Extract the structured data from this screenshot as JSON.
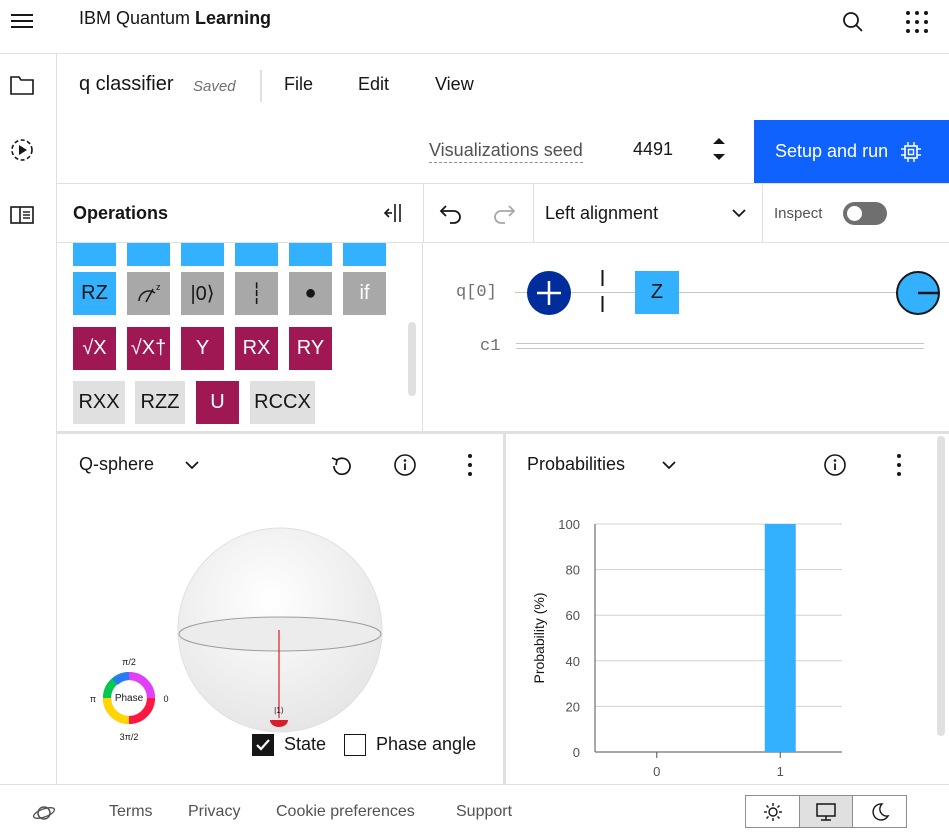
{
  "header": {
    "brand_prefix": "IBM Quantum ",
    "brand_bold": "Learning"
  },
  "composer": {
    "file_title": "q classifier",
    "saved_status": "Saved",
    "menu": [
      "File",
      "Edit",
      "View"
    ],
    "seed_label": "Visualizations seed",
    "seed_value": "4491",
    "run_label": "Setup and run"
  },
  "toolbar": {
    "operations_title": "Operations",
    "alignment": "Left alignment",
    "inspect_label": "Inspect",
    "inspect_on": false
  },
  "palette": {
    "row1": [
      "RZ",
      "",
      "|0⟩",
      "┆",
      "●",
      "if"
    ],
    "row2": [
      "√X",
      "√X†",
      "Y",
      "RX",
      "RY"
    ],
    "row3": [
      "RXX",
      "RZZ",
      "U",
      "RCCX"
    ]
  },
  "circuit": {
    "qubit_label": "q[0]",
    "classical_label": "c1",
    "gate_z": "Z"
  },
  "qsphere": {
    "title": "Q-sphere",
    "phase_label": "Phase",
    "phase_top": "π/2",
    "phase_left": "π",
    "phase_right": "0",
    "phase_bottom": "3π/2",
    "state_ket": "|1⟩",
    "state_checkbox": "State",
    "state_checked": true,
    "phase_checkbox": "Phase angle",
    "phase_checked": false
  },
  "probabilities": {
    "title": "Probabilities"
  },
  "chart_data": {
    "type": "bar",
    "categories": [
      "0",
      "1"
    ],
    "values": [
      0,
      100
    ],
    "ylabel": "Probability (%)",
    "xlabel": "",
    "ylim": [
      0,
      100
    ],
    "yticks": [
      0,
      20,
      40,
      60,
      80,
      100
    ],
    "grid": true,
    "bar_color": "#33b1ff"
  },
  "footer": {
    "links": [
      "Terms",
      "Privacy",
      "Cookie preferences",
      "Support"
    ],
    "theme_selected": "system"
  },
  "colors": {
    "primary": "#0f62fe",
    "gate_blue": "#33b1ff",
    "gate_magenta": "#9f1853",
    "gate_gray": "#a8a8a8",
    "gate_dark_blue": "#002d9c"
  }
}
